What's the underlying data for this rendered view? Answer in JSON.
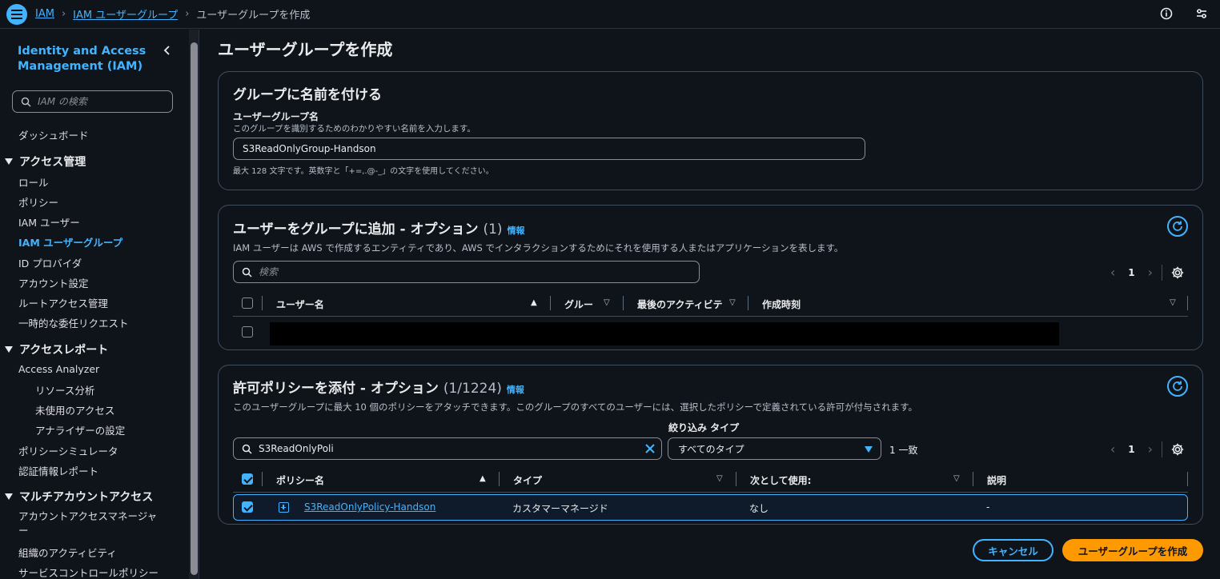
{
  "breadcrumb": {
    "items": [
      "IAM",
      "IAM ユーザーグループ"
    ],
    "current": "ユーザーグループを作成"
  },
  "sidebar": {
    "title": "Identity and Access Management (IAM)",
    "search_placeholder": "IAM の検索",
    "dashboard": "ダッシュボード",
    "sections": [
      {
        "title": "アクセス管理",
        "items": [
          "ロール",
          "ポリシー",
          "IAM ユーザー",
          "IAM ユーザーグループ",
          "ID プロバイダ",
          "アカウント設定",
          "ルートアクセス管理",
          "一時的な委任リクエスト"
        ]
      },
      {
        "title": "アクセスレポート",
        "items": [
          "Access Analyzer",
          "リソース分析",
          "未使用のアクセス",
          "アナライザーの設定",
          "ポリシーシミュレータ",
          "認証情報レポート"
        ]
      },
      {
        "title": "マルチアカウントアクセス",
        "items": [
          "アカウントアクセスマネージャー",
          "組織のアクティビティ",
          "サービスコントロールポリシー"
        ]
      }
    ],
    "active_item": "IAM ユーザーグループ"
  },
  "page": {
    "title": "ユーザーグループを作成"
  },
  "name_panel": {
    "title": "グループに名前を付ける",
    "label": "ユーザーグループ名",
    "sublabel": "このグループを識別するためのわかりやすい名前を入力します。",
    "value": "S3ReadOnlyGroup-Handson",
    "hint": "最大 128 文字です。英数字と「+=,.@-_」の文字を使用してください。"
  },
  "users_panel": {
    "title": "ユーザーをグループに追加 - オプション",
    "count": "(1)",
    "info": "情報",
    "description": "IAM ユーザーは AWS で作成するエンティティであり、AWS でインタラクションするためにそれを使用する人またはアプリケーションを表します。",
    "search_placeholder": "検索",
    "page": "1",
    "columns": [
      "ユーザー名",
      "グルー",
      "最後のアクティビテ",
      "作成時刻"
    ]
  },
  "policy_panel": {
    "title": "許可ポリシーを添付 - オプション",
    "count": "(1/1224)",
    "info": "情報",
    "description": "このユーザーグループに最大 10 個のポリシーをアタッチできます。このグループのすべてのユーザーには、選択したポリシーで定義されている許可が付与されます。",
    "search_value": "S3ReadOnlyPoli",
    "filter_label": "絞り込み タイプ",
    "filter_value": "すべてのタイプ",
    "match": "1 一致",
    "page": "1",
    "columns": [
      "ポリシー名",
      "タイプ",
      "次として使用:",
      "説明"
    ],
    "rows": [
      {
        "name": "S3ReadOnlyPolicy-Handson",
        "type": "カスタマーマネージド",
        "used_as": "なし",
        "description": "-"
      }
    ]
  },
  "actions": {
    "cancel": "キャンセル",
    "create": "ユーザーグループを作成"
  },
  "colors": {
    "accent": "#42b4ff",
    "primary": "#ff9900",
    "background": "#0f141a",
    "border": "#414d5c"
  }
}
